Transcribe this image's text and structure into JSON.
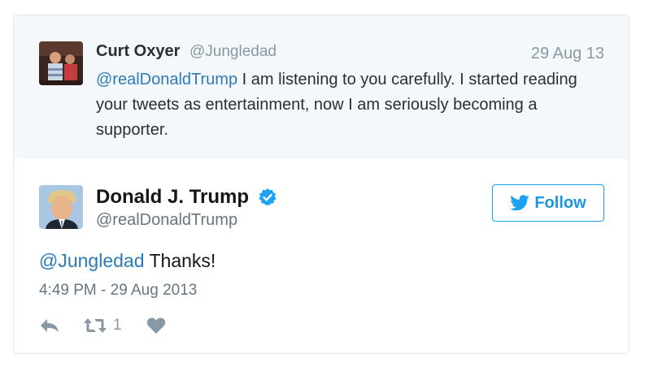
{
  "parent_tweet": {
    "name": "Curt Oxyer",
    "handle": "@Jungledad",
    "date": "29 Aug 13",
    "mention": "@realDonaldTrump",
    "text": " I am listening to you carefully. I started reading your tweets as entertainment, now I am seriously becoming a supporter."
  },
  "tweet": {
    "name": "Donald J. Trump",
    "handle": "@realDonaldTrump",
    "follow_label": "Follow",
    "mention": "@Jungledad",
    "text": " Thanks!",
    "timestamp": "4:49 PM - 29 Aug 2013",
    "retweet_count": "1"
  },
  "icons": {
    "verified": "verified-badge-icon",
    "twitter_bird": "twitter-bird-icon",
    "reply": "reply-icon",
    "retweet": "retweet-icon",
    "like": "heart-icon"
  },
  "colors": {
    "link": "#2b7bb9",
    "brand_blue": "#1da1f2",
    "muted": "#8899a6",
    "parent_bg": "#f5f8fa"
  }
}
